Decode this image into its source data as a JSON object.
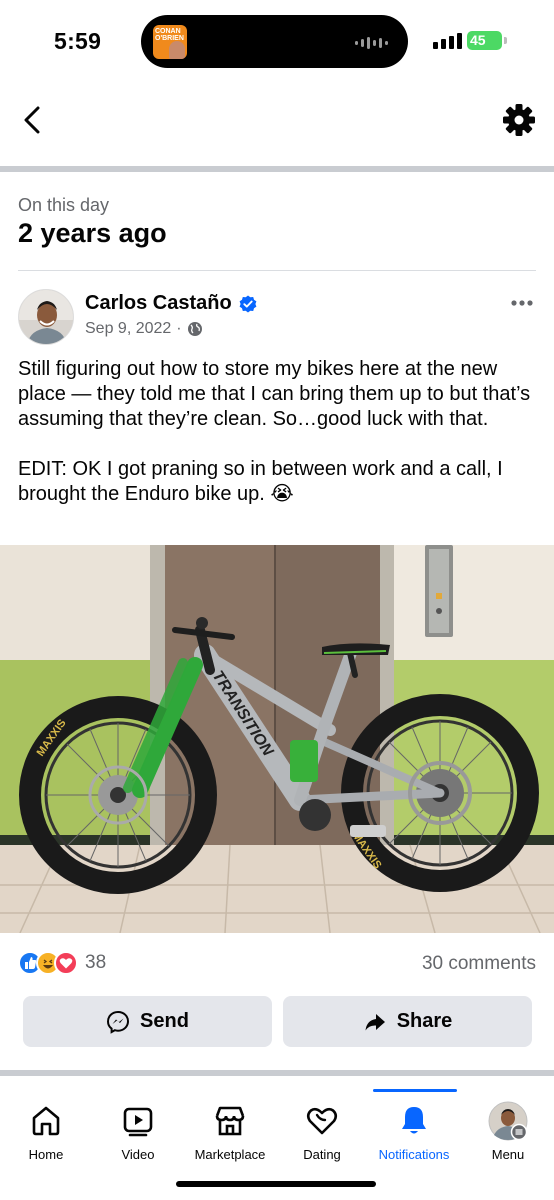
{
  "status_bar": {
    "time": "5:59",
    "battery": "45",
    "live_activity_text": "CONAN O'BRIEN"
  },
  "header": {
    "back_icon": "chevron-left-icon",
    "settings_icon": "gear-icon"
  },
  "memory": {
    "label": "On this day",
    "title": "2 years ago"
  },
  "post": {
    "author": "Carlos Castaño",
    "date": "Sep 9, 2022",
    "separator": "·",
    "privacy_icon": "globe-icon",
    "text_line1": "Still figuring out how to store my bikes here at the new place — they told me that I can bring them up to but that’s assuming that they’re clean. So…good luck with that.",
    "text_line2": "EDIT: OK I got praning so in between work and a call, I brought the Enduro bike up. 😭",
    "photo_bike_brand": "TRANSITION",
    "photo_tire_brand": "MAXXIS",
    "reaction_count": "38",
    "comments": "30 comments",
    "send_label": "Send",
    "share_label": "Share"
  },
  "colors": {
    "accent": "#0866ff",
    "like": "#1877f2",
    "love": "#f33e58",
    "haha": "#f7b125"
  },
  "tabs": [
    {
      "label": "Home",
      "icon": "home-icon"
    },
    {
      "label": "Video",
      "icon": "video-icon"
    },
    {
      "label": "Marketplace",
      "icon": "marketplace-icon"
    },
    {
      "label": "Dating",
      "icon": "dating-icon"
    },
    {
      "label": "Notifications",
      "icon": "bell-icon",
      "active": true
    },
    {
      "label": "Menu",
      "icon": "avatar-icon"
    }
  ]
}
